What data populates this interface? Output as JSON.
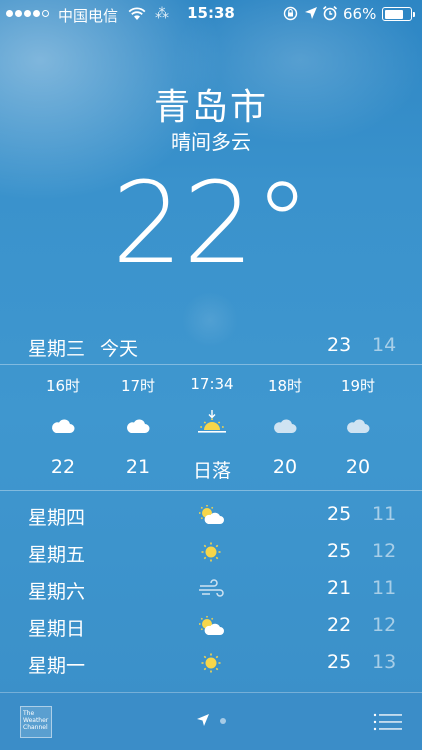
{
  "status": {
    "carrier": "中国电信",
    "time": "15:38",
    "battery": "66%",
    "battery_level": 0.66
  },
  "location": {
    "city": "青岛市",
    "condition": "晴间多云",
    "temperature": "22°"
  },
  "today": {
    "day": "星期三",
    "label": "今天",
    "high": "23",
    "low": "14"
  },
  "hourly": [
    {
      "time": "16时",
      "icon": "cloud-icon",
      "temp": "22"
    },
    {
      "time": "17时",
      "icon": "cloud-icon",
      "temp": "21"
    },
    {
      "time": "17:34",
      "icon": "sunset-icon",
      "temp": "日落"
    },
    {
      "time": "18时",
      "icon": "cloud-icon",
      "temp": "20"
    },
    {
      "time": "19时",
      "icon": "cloud-icon",
      "temp": "20"
    }
  ],
  "daily": [
    {
      "day": "星期四",
      "icon": "partly-cloudy-icon",
      "high": "25",
      "low": "11"
    },
    {
      "day": "星期五",
      "icon": "sun-icon",
      "high": "25",
      "low": "12"
    },
    {
      "day": "星期六",
      "icon": "wind-icon",
      "high": "21",
      "low": "11"
    },
    {
      "day": "星期日",
      "icon": "partly-cloudy-icon",
      "high": "22",
      "low": "12"
    },
    {
      "day": "星期一",
      "icon": "sun-icon",
      "high": "25",
      "low": "13"
    }
  ],
  "footer": {
    "logo_text": "The Weather Channel"
  }
}
